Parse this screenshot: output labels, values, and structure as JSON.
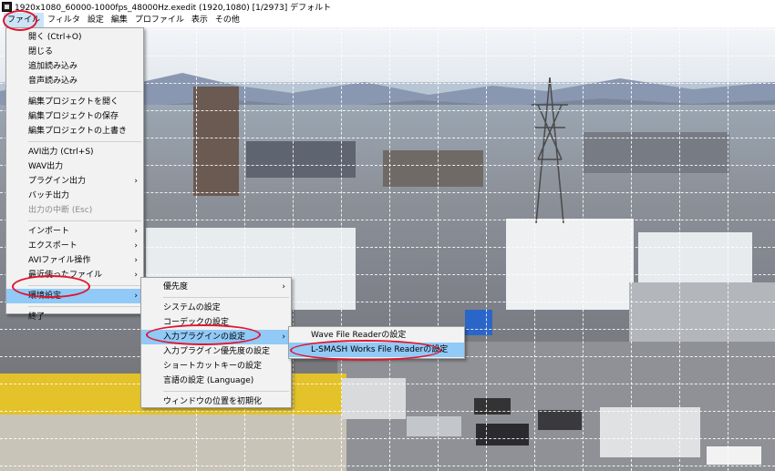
{
  "window": {
    "title": "1920x1080_60000-1000fps_48000Hz.exedit (1920,1080)  [1/2973]  デフォルト"
  },
  "menubar": {
    "items": [
      "ファイル",
      "フィルタ",
      "設定",
      "編集",
      "プロファイル",
      "表示",
      "その他"
    ]
  },
  "file_menu": {
    "open": "開く (Ctrl+O)",
    "close": "閉じる",
    "add_load": "追加読み込み",
    "audio_load": "音声読み込み",
    "open_project": "編集プロジェクトを開く",
    "save_project": "編集プロジェクトの保存",
    "overwrite_project": "編集プロジェクトの上書き",
    "avi_output": "AVI出力 (Ctrl+S)",
    "wav_output": "WAV出力",
    "plugin_output": "プラグイン出力",
    "batch_output": "バッチ出力",
    "stop_output": "出力の中断 (Esc)",
    "import": "インポート",
    "export": "エクスポート",
    "avi_ops": "AVIファイル操作",
    "recent": "最近使ったファイル",
    "env_settings": "環境設定",
    "exit": "終了"
  },
  "env_menu": {
    "priority": "優先度",
    "system": "システムの設定",
    "codec": "コーデックの設定",
    "input_plugin": "入力プラグインの設定",
    "input_plugin_priority": "入力プラグイン優先度の設定",
    "shortcut": "ショートカットキーの設定",
    "language": "言語の設定 (Language)",
    "window_reset": "ウィンドウの位置を初期化"
  },
  "plugin_menu": {
    "wave_reader": "Wave File Readerの設定",
    "lsmash_reader": "L-SMASH Works File Readerの設定"
  },
  "colors": {
    "highlight": "#91c9f7",
    "annotation_red": "#e2142d"
  }
}
